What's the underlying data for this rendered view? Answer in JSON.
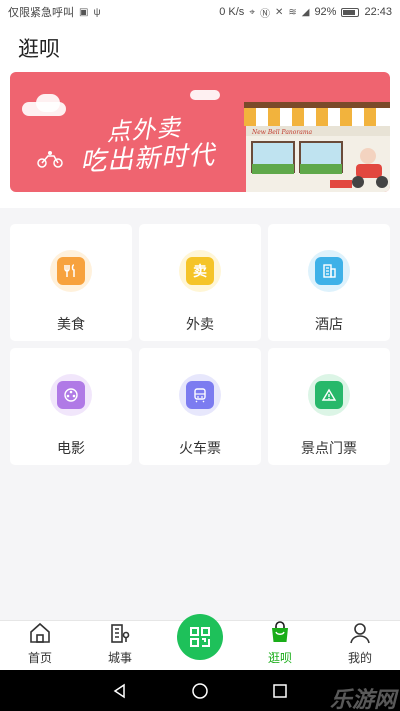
{
  "status_bar": {
    "carrier": "仅限紧急呼叫",
    "speed": "0 K/s",
    "battery": "92%",
    "time": "22:43"
  },
  "header": {
    "title": "逛呗"
  },
  "banner": {
    "line1": "点外卖",
    "line2": "吃出新时代",
    "shop_sign": "New Bell Panorama",
    "colors": {
      "background": "#ef6470"
    }
  },
  "categories": [
    {
      "label": "美食",
      "icon": "utensils-icon",
      "color": "#f7a23e",
      "halo": "#fff1dc"
    },
    {
      "label": "外卖",
      "icon": "takeout-icon",
      "color": "#f5c428",
      "halo": "#fff6d6"
    },
    {
      "label": "酒店",
      "icon": "hotel-icon",
      "color": "#3eb1e8",
      "halo": "#def2fc"
    },
    {
      "label": "电影",
      "icon": "film-reel-icon",
      "color": "#b07ae6",
      "halo": "#f1e6fb"
    },
    {
      "label": "火车票",
      "icon": "train-icon",
      "color": "#7c7cf0",
      "halo": "#e7e7fc"
    },
    {
      "label": "景点门票",
      "icon": "mountain-ticket-icon",
      "color": "#27b86a",
      "halo": "#dcf5e6"
    }
  ],
  "bottom_nav": {
    "items": [
      {
        "label": "首页",
        "icon": "home-icon"
      },
      {
        "label": "城事",
        "icon": "city-icon"
      },
      {
        "label": "",
        "icon": "qr-scan-icon"
      },
      {
        "label": "逛呗",
        "icon": "shopping-bag-icon"
      },
      {
        "label": "我的",
        "icon": "user-icon"
      }
    ],
    "active_index": 3,
    "accent": "#1aad19"
  },
  "watermark": "乐游网"
}
